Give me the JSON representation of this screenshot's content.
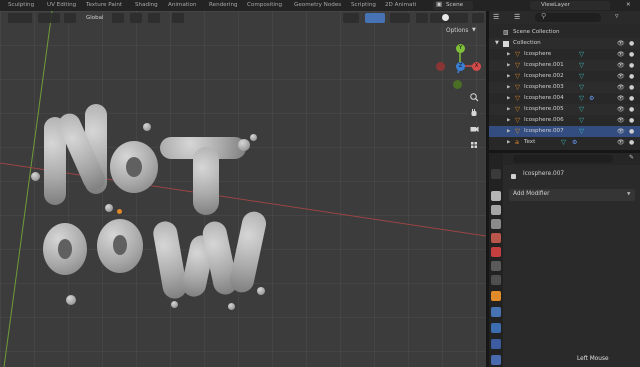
{
  "workspace_tabs": [
    "Sculpting",
    "UV Editing",
    "Texture Paint",
    "Shading",
    "Animation",
    "Rendering",
    "Compositing",
    "Geometry Nodes",
    "Scripting",
    "2D Animati"
  ],
  "scene": "Scene",
  "view_layer": "ViewLayer",
  "viewport": {
    "orientation": "Global",
    "options_label": "Options",
    "gizmo_axes": {
      "x": "X",
      "y": "Y",
      "z": "Z"
    }
  },
  "outliner": {
    "scene_collection": "Scene Collection",
    "collection": "Collection",
    "items": [
      {
        "label": "Icosphere"
      },
      {
        "label": "Icosphere.001"
      },
      {
        "label": "Icosphere.002"
      },
      {
        "label": "Icosphere.003"
      },
      {
        "label": "Icosphere.004"
      },
      {
        "label": "Icosphere.005"
      },
      {
        "label": "Icosphere.006"
      },
      {
        "label": "Icosphere.007"
      },
      {
        "label": "Text"
      }
    ]
  },
  "properties": {
    "object_name": "Icosphere.007",
    "add_modifier": "Add Modifier"
  },
  "status": {
    "left_mouse": "Left Mouse"
  },
  "colors": {
    "accent": "#4772b3",
    "x_axis": "#d44b4b",
    "y_axis": "#7fbf3a",
    "z_axis": "#3a7fd4"
  }
}
